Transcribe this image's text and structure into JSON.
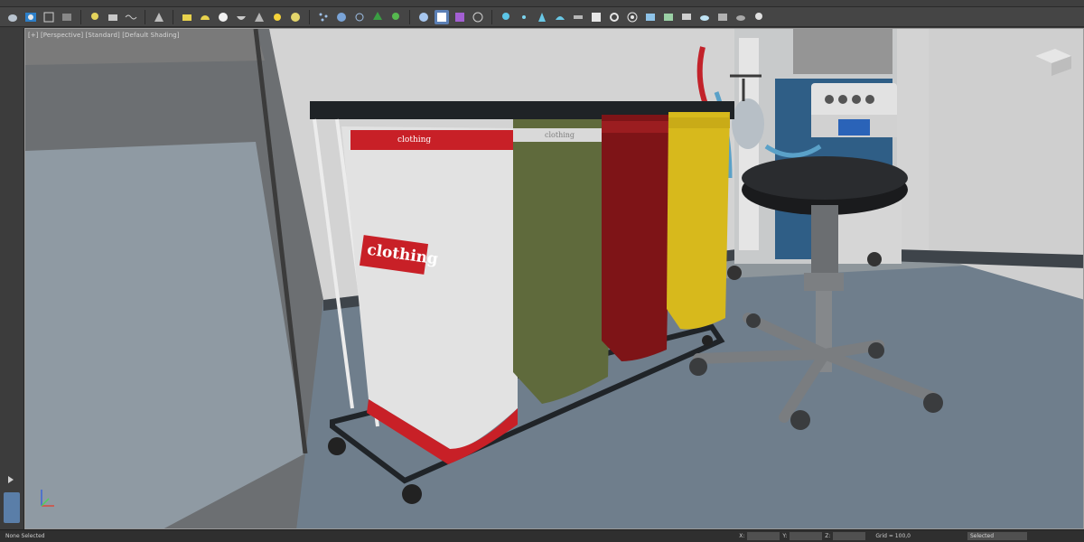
{
  "viewport": {
    "label": "[+] [Perspective] [Standard] [Default Shading]"
  },
  "scene": {
    "bag_brand_large": "clothing",
    "bag_brand_small": "clothing",
    "bags": [
      {
        "name": "white",
        "color": "#e2e2e2"
      },
      {
        "name": "green",
        "color": "#5f6a3c"
      },
      {
        "name": "red",
        "color": "#7e1417"
      },
      {
        "name": "yellow",
        "color": "#d7b91c"
      }
    ]
  },
  "status": {
    "left_text": "None Selected",
    "x_label": "X:",
    "x_value": "",
    "y_label": "Y:",
    "y_value": "",
    "z_label": "Z:",
    "z_value": "",
    "grid_text": "Grid = 100,0",
    "selection_dropdown": "Selected"
  },
  "colors": {
    "accent": "#5b7fb5",
    "viewport_bg": "#8e969b",
    "floor": "#6f7e8c",
    "wall": "#d2d2d2"
  }
}
